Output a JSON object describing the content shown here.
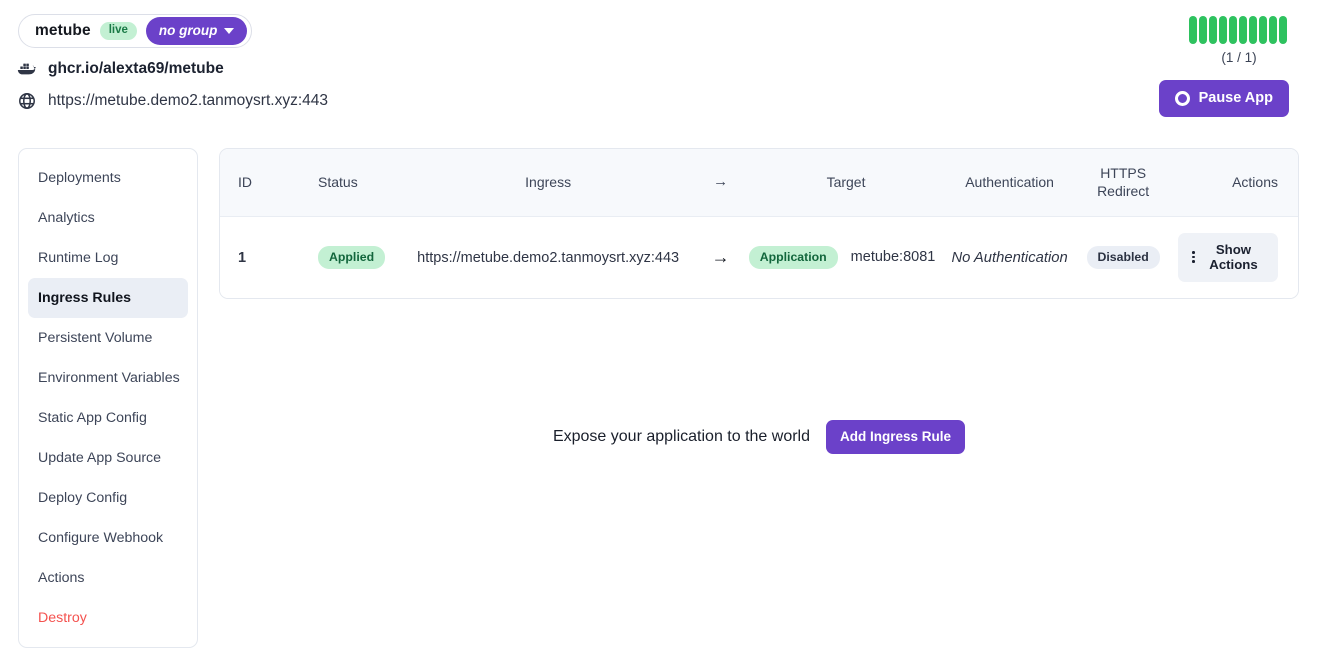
{
  "header": {
    "app_name": "metube",
    "live_badge": "live",
    "group_label": "no group",
    "image_icon": "docker-whale-icon",
    "image_text": "ghcr.io/alexta69/metube",
    "url_icon": "globe-icon",
    "url_text": "https://metube.demo2.tanmoysrt.xyz:443",
    "replica_label": "(1 / 1)",
    "replica_bars": 10,
    "replica_bar_color": "#2ec25f",
    "pause_button": "Pause App",
    "accent_color": "#6b41c9"
  },
  "sidebar": {
    "items": [
      {
        "label": "Deployments",
        "active": false,
        "danger": false
      },
      {
        "label": "Analytics",
        "active": false,
        "danger": false
      },
      {
        "label": "Runtime Log",
        "active": false,
        "danger": false
      },
      {
        "label": "Ingress Rules",
        "active": true,
        "danger": false
      },
      {
        "label": "Persistent Volume",
        "active": false,
        "danger": false
      },
      {
        "label": "Environment Variables",
        "active": false,
        "danger": false
      },
      {
        "label": "Static App Config",
        "active": false,
        "danger": false
      },
      {
        "label": "Update App Source",
        "active": false,
        "danger": false
      },
      {
        "label": "Deploy Config",
        "active": false,
        "danger": false
      },
      {
        "label": "Configure Webhook",
        "active": false,
        "danger": false
      },
      {
        "label": "Actions",
        "active": false,
        "danger": false
      },
      {
        "label": "Destroy",
        "active": false,
        "danger": true
      }
    ]
  },
  "table": {
    "columns": [
      {
        "label": "ID",
        "key": "id"
      },
      {
        "label": "Status",
        "key": "status"
      },
      {
        "label": "Ingress",
        "key": "ingress"
      },
      {
        "label": "→",
        "key": "arrow"
      },
      {
        "label": "Target",
        "key": "target"
      },
      {
        "label": "Authentication",
        "key": "auth"
      },
      {
        "label": "HTTPS Redirect",
        "key": "https"
      },
      {
        "label": "Actions",
        "key": "actions"
      }
    ],
    "rows": [
      {
        "id": "1",
        "status": "Applied",
        "ingress": "https://metube.demo2.tanmoysrt.xyz:443",
        "arrow": "→",
        "target_type": "Application",
        "target": "metube:8081",
        "auth": "No Authentication",
        "https": "Disabled",
        "actions": "Show Actions"
      }
    ]
  },
  "expose": {
    "text": "Expose your application to the world",
    "button": "Add Ingress Rule"
  }
}
